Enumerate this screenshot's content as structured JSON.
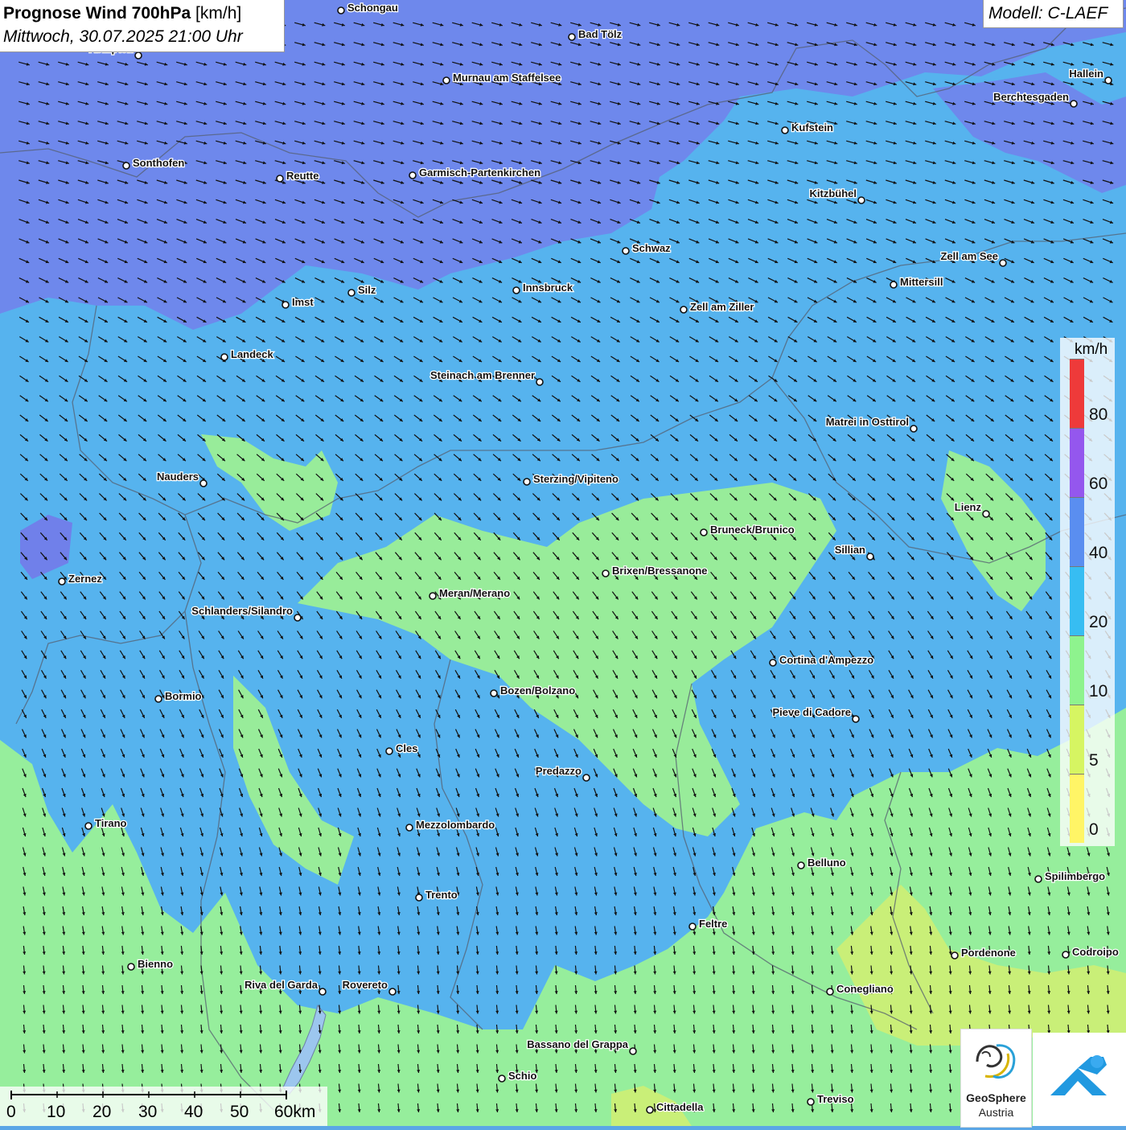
{
  "title": {
    "main": "Prognose Wind 700hPa",
    "unit": "[km/h]",
    "date": "Mittwoch, 30.07.2025 21:00 Uhr"
  },
  "model": "Modell: C-LAEF",
  "legend": {
    "unit": "km/h",
    "classes": [
      {
        "label": "0",
        "color": "#fff566"
      },
      {
        "label": "5",
        "color": "#d6f562"
      },
      {
        "label": "10",
        "color": "#8ef38e"
      },
      {
        "label": "20",
        "color": "#37bdf2"
      },
      {
        "label": "40",
        "color": "#5a8ef0"
      },
      {
        "label": "60",
        "color": "#9457ee"
      },
      {
        "label": "80",
        "color": "#ee3a3a"
      }
    ]
  },
  "scale": {
    "labels": [
      "0",
      "10",
      "20",
      "30",
      "40",
      "50",
      "60km"
    ]
  },
  "cities": [
    {
      "name": "Schongau"
    },
    {
      "name": "Bad Tölz"
    },
    {
      "name": "Kempten"
    },
    {
      "name": "Murnau am Staffelsee"
    },
    {
      "name": "Hallein"
    },
    {
      "name": "Berchtesgaden"
    },
    {
      "name": "Kufstein"
    },
    {
      "name": "Sonthofen"
    },
    {
      "name": "Reutte"
    },
    {
      "name": "Garmisch-Partenkirchen"
    },
    {
      "name": "Kitzbühel"
    },
    {
      "name": "Schwaz"
    },
    {
      "name": "Zell am See"
    },
    {
      "name": "Mittersill"
    },
    {
      "name": "Innsbruck"
    },
    {
      "name": "Silz"
    },
    {
      "name": "Imst"
    },
    {
      "name": "Zell am Ziller"
    },
    {
      "name": "Landeck"
    },
    {
      "name": "Steinach am Brenner"
    },
    {
      "name": "Matrei in Osttirol"
    },
    {
      "name": "Nauders"
    },
    {
      "name": "Sterzing/Vipiteno"
    },
    {
      "name": "Lienz"
    },
    {
      "name": "Bruneck/Brunico"
    },
    {
      "name": "Sillian"
    },
    {
      "name": "Brixen/Bressanone"
    },
    {
      "name": "Zernez"
    },
    {
      "name": "Meran/Merano"
    },
    {
      "name": "Schlanders/Silandro"
    },
    {
      "name": "Cortina d'Ampezzo"
    },
    {
      "name": "Bozen/Bolzano"
    },
    {
      "name": "Bormio"
    },
    {
      "name": "Pieve di Cadore"
    },
    {
      "name": "Cles"
    },
    {
      "name": "Predazzo"
    },
    {
      "name": "Tirano"
    },
    {
      "name": "Mezzolombardo"
    },
    {
      "name": "Belluno"
    },
    {
      "name": "Spilimbergo"
    },
    {
      "name": "Trento"
    },
    {
      "name": "Feltre"
    },
    {
      "name": "Bienno"
    },
    {
      "name": "Pordenone"
    },
    {
      "name": "Codroipo"
    },
    {
      "name": "Riva del Garda"
    },
    {
      "name": "Rovereto"
    },
    {
      "name": "Conegliano"
    },
    {
      "name": "Bassano del Grappa"
    },
    {
      "name": "Schio"
    },
    {
      "name": "Treviso"
    },
    {
      "name": "Cittadella"
    }
  ],
  "logos": {
    "geosphere_name": "GeoSphere",
    "geosphere_country": "Austria"
  },
  "colors": {
    "band_purple": "#6e86ea",
    "band_blue": "#5aa6e6",
    "band_green": "#98ec9a",
    "band_yellowgreen": "#c8ee78"
  }
}
